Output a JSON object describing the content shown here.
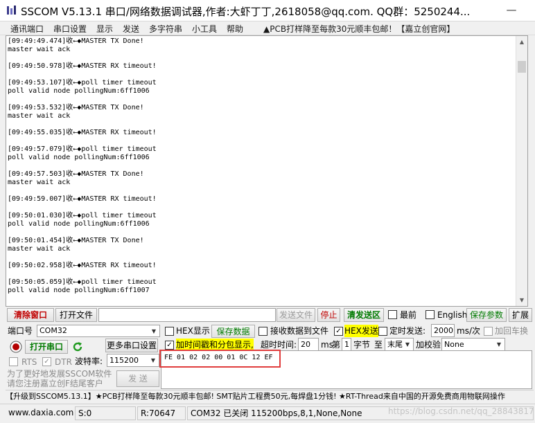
{
  "window": {
    "title": "SSCOM V5.13.1 串口/网络数据调试器,作者:大虾丁丁,2618058@qq.com. QQ群：5250244...",
    "minimize_glyph": "—"
  },
  "menu": {
    "items": [
      "通讯端口",
      "串口设置",
      "显示",
      "发送",
      "多字符串",
      "小工具",
      "帮助"
    ],
    "promo": "▲PCB打样降至每款30元顺丰包邮！【嘉立创官网】"
  },
  "log": {
    "lines": [
      "[09:49:49.474]收←◆MASTER TX Done!",
      "master wait ack",
      "",
      "[09:49:50.978]收←◆MASTER RX timeout!",
      "",
      "[09:49:53.107]收←◆poll timer timeout",
      "poll valid node pollingNum:6ff1006",
      "",
      "[09:49:53.532]收←◆MASTER TX Done!",
      "master wait ack",
      "",
      "[09:49:55.035]收←◆MASTER RX timeout!",
      "",
      "[09:49:57.079]收←◆poll timer timeout",
      "poll valid node pollingNum:6ff1006",
      "",
      "[09:49:57.503]收←◆MASTER TX Done!",
      "master wait ack",
      "",
      "[09:49:59.007]收←◆MASTER RX timeout!",
      "",
      "[09:50:01.030]收←◆poll timer timeout",
      "poll valid node pollingNum:6ff1006",
      "",
      "[09:50:01.454]收←◆MASTER TX Done!",
      "master wait ack",
      "",
      "[09:50:02.958]收←◆MASTER RX timeout!",
      "",
      "[09:50:05.059]收←◆poll timer timeout",
      "poll valid node pollingNum:6ff1007"
    ]
  },
  "toolbar": {
    "clear_window": "清除窗口",
    "open_file": "打开文件",
    "send_file": "发送文件",
    "stop": "停止",
    "clear_send": "清发送区",
    "topmost": "最前",
    "english": "English",
    "save_params": "保存参数",
    "expand": "扩展"
  },
  "port": {
    "port_label": "端口号",
    "port_value": "COM32",
    "open_port": "打开串口",
    "more_settings": "更多串口设置",
    "rts": "RTS",
    "dtr": "DTR",
    "baud_label": "波特率:",
    "baud_value": "115200"
  },
  "options": {
    "hex_display": "HEX显示",
    "save_data": "保存数据",
    "recv_to_file": "接收数据到文件",
    "hex_send": "HEX发送",
    "timed_send": "定时发送:",
    "interval": "2000",
    "interval_unit": "ms/次",
    "add_crlf": "加回车换",
    "timestamp": "加时间戳和分包显示,",
    "timeout_label": "超时时间:",
    "timeout_value": "20",
    "timeout_unit": "ms",
    "byte_nth": "第",
    "byte_start": "1",
    "byte_label": "字节",
    "to": "至",
    "end_value": "末尾",
    "checksum_label": "加校验",
    "checksum_value": "None"
  },
  "send": {
    "text": "FE 01 02 02 00 01 0C 12 EF",
    "button": "发  送"
  },
  "left_msg": [
    "为了更好地发展SSCOM软件",
    "请您注册嘉立创F结尾客户"
  ],
  "ad_text": "【升级到SSCOM5.13.1】★PCB打样降至每款30元顺丰包邮! SMT贴片工程费50元,每焊盘1分钱! ★RT-Thread来自中国的开源免费商用物联网操作",
  "status": {
    "website": "www.daxia.com",
    "sent": "S:0",
    "received": "R:70647",
    "port_state": "COM32 已关闭  115200bps,8,1,None,None"
  },
  "watermark": "https://blog.csdn.net/qq_28843817"
}
